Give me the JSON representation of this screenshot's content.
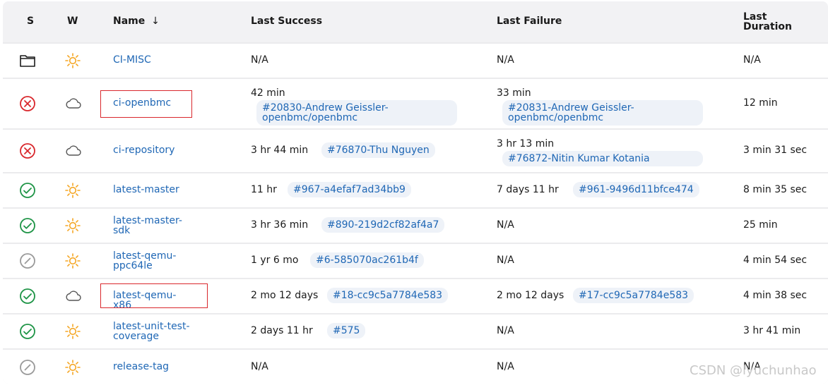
{
  "columns": {
    "status": "S",
    "weather": "W",
    "name": "Name",
    "sort_arrow": "↓",
    "last_success": "Last Success",
    "last_failure": "Last Failure",
    "last_duration": "Last Duration"
  },
  "rows": [
    {
      "status": "folder",
      "weather": "sunny",
      "name": "CI-MISC",
      "success_time": "N/A",
      "success_build": "",
      "failure_time": "N/A",
      "failure_build": "",
      "duration": "N/A"
    },
    {
      "status": "failed",
      "weather": "cloudy",
      "name": "ci-openbmc",
      "success_time": "42 min",
      "success_build": "#20830-Andrew Geissler-openbmc/openbmc",
      "failure_time": "33 min",
      "failure_build": "#20831-Andrew Geissler-openbmc/openbmc",
      "duration": "12 min"
    },
    {
      "status": "failed",
      "weather": "cloudy",
      "name": "ci-repository",
      "success_time": "3 hr 44 min",
      "success_build": "#76870-Thu Nguyen",
      "failure_time": "3 hr 13 min",
      "failure_build": "#76872-Nitin Kumar Kotania",
      "duration": "3 min 31 sec"
    },
    {
      "status": "success",
      "weather": "sunny",
      "name": "latest-master",
      "success_time": "11 hr",
      "success_build": "#967-a4efaf7ad34bb9",
      "failure_time": "7 days 11 hr",
      "failure_build": "#961-9496d11bfce474",
      "duration": "8 min 35 sec"
    },
    {
      "status": "success",
      "weather": "sunny",
      "name": "latest-master-sdk",
      "success_time": "3 hr 36 min",
      "success_build": "#890-219d2cf82af4a7",
      "failure_time": "N/A",
      "failure_build": "",
      "duration": "25 min"
    },
    {
      "status": "disabled",
      "weather": "sunny",
      "name": "latest-qemu-ppc64le",
      "success_time": "1 yr 6 mo",
      "success_build": "#6-585070ac261b4f",
      "failure_time": "N/A",
      "failure_build": "",
      "duration": "4 min 54 sec"
    },
    {
      "status": "success",
      "weather": "cloudy",
      "name": "latest-qemu-x86",
      "success_time": "2 mo 12 days",
      "success_build": "#18-cc9c5a7784e583",
      "failure_time": "2 mo 12 days",
      "failure_build": "#17-cc9c5a7784e583",
      "duration": "4 min 38 sec"
    },
    {
      "status": "success",
      "weather": "sunny",
      "name": "latest-unit-test-coverage",
      "success_time": "2 days 11 hr",
      "success_build": "#575",
      "failure_time": "N/A",
      "failure_build": "",
      "duration": "3 hr 41 min"
    },
    {
      "status": "disabled",
      "weather": "sunny",
      "name": "release-tag",
      "success_time": "N/A",
      "success_build": "",
      "failure_time": "N/A",
      "failure_build": "",
      "duration": "N/A"
    }
  ],
  "watermark": "CSDN @lyuchunhao",
  "colors": {
    "link": "#1f67b5",
    "failed": "#d9272c",
    "success": "#1e9446",
    "disabled": "#9a9a9a",
    "sun": "#f5a623",
    "highlight_box": "#d9272c"
  }
}
